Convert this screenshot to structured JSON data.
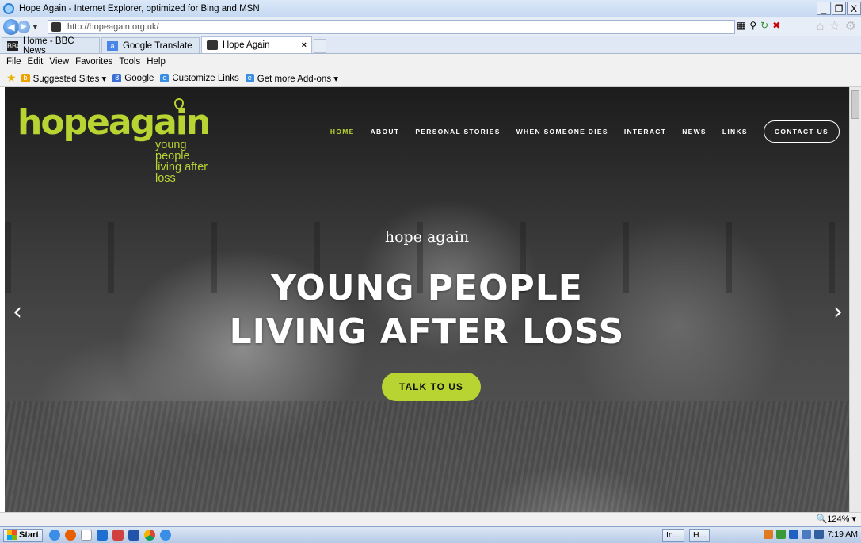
{
  "window": {
    "title": "Hope Again - Internet Explorer, optimized for Bing and MSN",
    "controls": [
      "_",
      "❐",
      "X"
    ]
  },
  "address_bar": {
    "url": "http://hopeagain.org.uk/"
  },
  "tabs": [
    {
      "label": "Home - BBC News",
      "icon": "bbc-icon",
      "active": false
    },
    {
      "label": "Google Translate",
      "icon": "translate-icon",
      "active": false
    },
    {
      "label": "Hope Again",
      "icon": "hope-again-icon",
      "active": true,
      "close": "×"
    }
  ],
  "menu": [
    "File",
    "Edit",
    "View",
    "Favorites",
    "Tools",
    "Help"
  ],
  "favorites": [
    {
      "label": "Suggested Sites ▾",
      "icon": "bing-icon",
      "color": "#f0a000"
    },
    {
      "label": "Google",
      "icon": "google-icon",
      "color": "#3b6fd6"
    },
    {
      "label": "Customize Links",
      "icon": "ie-page-icon",
      "color": "#3a8ee6"
    },
    {
      "label": "Get more Add-ons ▾",
      "icon": "ie-page-icon",
      "color": "#3a8ee6"
    }
  ],
  "site": {
    "logo": {
      "name": "hopeagain",
      "tagline_1": "young people",
      "tagline_2": "living after loss",
      "color": "#b8d432"
    },
    "nav": [
      {
        "label": "HOME",
        "active": true
      },
      {
        "label": "ABOUT",
        "active": false
      },
      {
        "label": "PERSONAL STORIES",
        "active": false
      },
      {
        "label": "WHEN SOMEONE DIES",
        "active": false
      },
      {
        "label": "INTERACT",
        "active": false
      },
      {
        "label": "NEWS",
        "active": false
      },
      {
        "label": "LINKS",
        "active": false
      }
    ],
    "contact_button": "CONTACT US",
    "hero": {
      "subtitle": "hope again",
      "title_line_1": "YOUNG PEOPLE",
      "title_line_2": "LIVING AFTER LOSS",
      "cta": "TALK TO US",
      "prev_arrow": "‹",
      "next_arrow": "›"
    }
  },
  "status_bar": {
    "zoom": "🔍124%  ▾"
  },
  "taskbar": {
    "start": "Start",
    "items": [
      "In...",
      "H..."
    ],
    "time": "7:19 AM"
  }
}
